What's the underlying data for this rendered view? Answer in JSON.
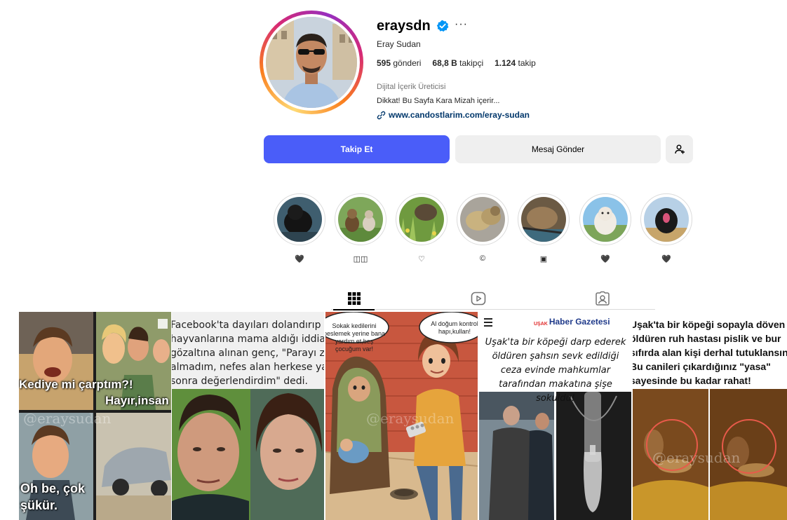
{
  "profile": {
    "username": "eraysdn",
    "full_name": "Eray Sudan",
    "more_glyph": "···",
    "posts_count": "595",
    "posts_label": "gönderi",
    "followers_count": "68,8 B",
    "followers_label": "takipçi",
    "following_count": "1.124",
    "following_label": "takip",
    "category": "Dijital İçerik Üreticisi",
    "bio": "Dikkat! Bu Sayfa Kara Mizah içerir...",
    "link": "www.candostlarim.com/eray-sudan"
  },
  "buttons": {
    "follow": "Takip Et",
    "message": "Mesaj Gönder"
  },
  "highlights": [
    {
      "label": "🖤"
    },
    {
      "label": "◫◫"
    },
    {
      "label": "♡"
    },
    {
      "label": "©"
    },
    {
      "label": "▣"
    },
    {
      "label": "🖤"
    },
    {
      "label": "🖤"
    }
  ],
  "tabs": [
    "posts-grid-icon",
    "reels-icon",
    "tagged-icon"
  ],
  "posts": [
    {
      "top_left": "Kediye mi çarptım?!",
      "top_right": "Hayır,insan",
      "bottom_left": "Oh be, çok şükür.",
      "watermark": "@eraysudan"
    },
    {
      "lines": [
        "Facebook'ta dayıları dolandırıp sokak",
        "hayvanlarına mama aldığı iddiası ile",
        "gözaltına alınan genç, \"Parayı zorla",
        "almadım, nefes alan herkese yazıyor",
        "sonra değerlendirdim\" dedi."
      ]
    },
    {
      "bubble_left": "Sokak kedilerini beslemek yerine bana yardım et,beş çocuğum var!",
      "bubble_right": "Al doğum kontrol hapı,kullan!",
      "watermark": "@eraysudan"
    },
    {
      "paper": "Haber Gazetesi",
      "paper_city": "UŞAK",
      "headline": "Uşak'ta bir köpeği darp ederek öldüren şahsın sevk edildiği ceza evinde mahkumlar tarafından makatına şişe sokuldu!"
    },
    {
      "lines": [
        "Uşak'ta bir köpeği sopayla döven",
        "öldüren ruh hastası pislik ve bur",
        "sıfırda alan kişi derhal tutuklansın.",
        "Bu canileri çıkardığınız \"yasa\"",
        "sayesinde bu kadar rahat!"
      ],
      "watermark": "@eraysudan"
    }
  ]
}
